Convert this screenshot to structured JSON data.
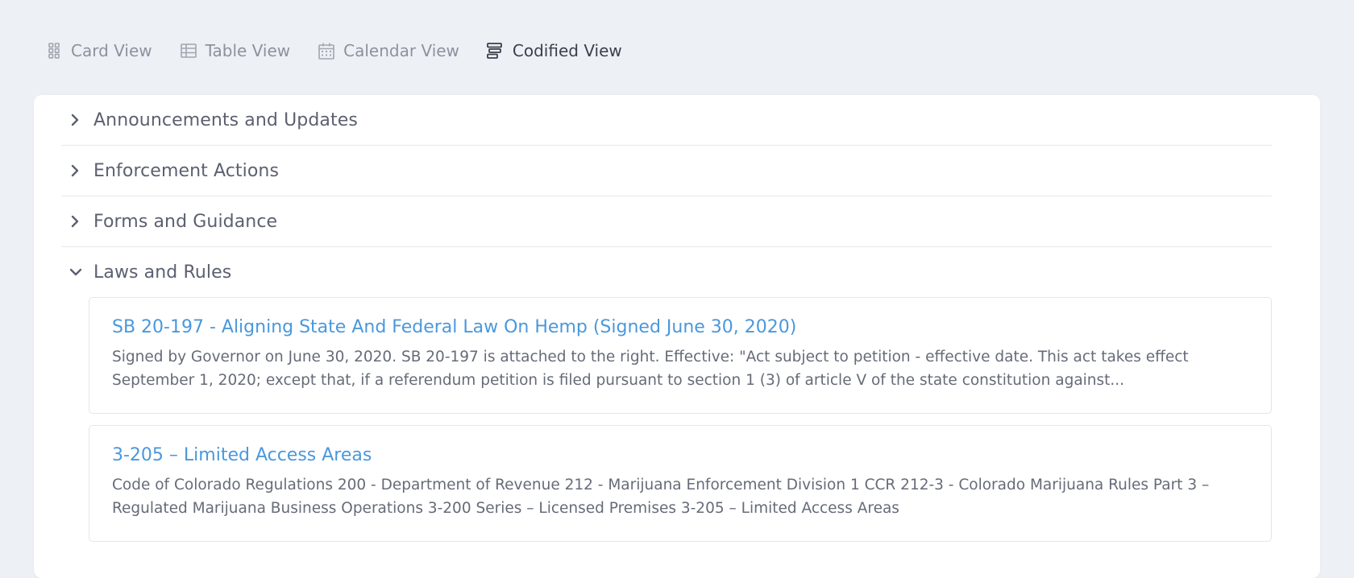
{
  "view_tabs": [
    {
      "label": "Card View",
      "icon": "grid-icon",
      "active": false
    },
    {
      "label": "Table View",
      "icon": "table-icon",
      "active": false
    },
    {
      "label": "Calendar View",
      "icon": "calendar-icon",
      "active": false
    },
    {
      "label": "Codified View",
      "icon": "codified-list-icon",
      "active": true
    }
  ],
  "sections": [
    {
      "title": "Announcements and Updates",
      "expanded": false
    },
    {
      "title": "Enforcement Actions",
      "expanded": false
    },
    {
      "title": "Forms and Guidance",
      "expanded": false
    },
    {
      "title": "Laws and Rules",
      "expanded": true,
      "entries": [
        {
          "title": "SB 20-197 - Aligning State And Federal Law On Hemp (Signed June 30, 2020)",
          "description": "Signed by Governor on June 30, 2020. SB 20-197 is attached to the right. Effective: \"Act subject to petition - effective date. This act takes effect September 1, 2020; except that, if a referendum petition is filed pursuant to section 1 (3) of article V of the state constitution against..."
        },
        {
          "title": "3-205 – Limited Access Areas",
          "description": "Code of Colorado Regulations 200 - Department of Revenue 212 - Marijuana Enforcement Division 1 CCR 212-3 - Colorado Marijuana Rules Part 3 – Regulated Marijuana Business Operations 3-200 Series – Licensed Premises 3-205 – Limited Access Areas"
        }
      ]
    }
  ],
  "colors": {
    "page_background": "#edf1f6",
    "link": "#4a98dc",
    "active_tab": "#3c3f4b",
    "inactive_tab": "#8d919c"
  }
}
